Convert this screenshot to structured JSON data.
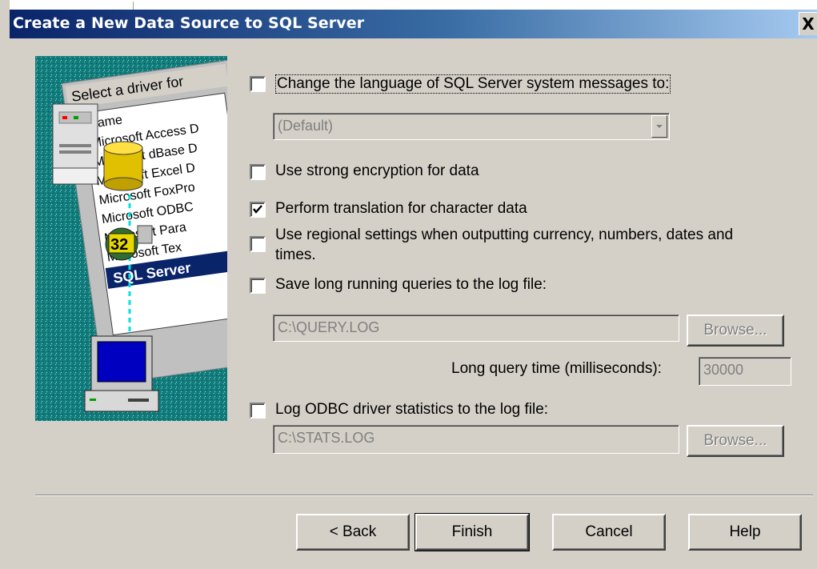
{
  "window": {
    "title": "Create a New Data Source to SQL Server",
    "close_glyph": "X"
  },
  "art": {
    "heading": "Select a driver for",
    "column": "Name",
    "drivers": [
      "Microsoft Access D",
      "Microsoft dBase D",
      "Microsoft Excel D",
      "Microsoft FoxPro",
      "Microsoft ODBC",
      "Microsoft Para",
      "Microsoft Tex",
      "SQL Server"
    ],
    "badge": "32",
    "icons": [
      "server-icon",
      "database-icon",
      "globe-icon",
      "computer-icon"
    ]
  },
  "options": {
    "change_language": {
      "label": "Change the language of SQL Server system messages to:",
      "checked": false
    },
    "language_combo": {
      "value": "(Default)"
    },
    "strong_encryption": {
      "label": "Use strong encryption for data",
      "checked": false
    },
    "translation": {
      "label": "Perform translation for character data",
      "checked": true
    },
    "regional": {
      "label_line1": "Use regional settings when outputting currency, numbers, dates and",
      "label_line2": "times.",
      "checked": false
    },
    "save_long_queries": {
      "label": "Save long running queries to the log file:",
      "checked": false
    },
    "query_log_path": {
      "value": "C:\\QUERY.LOG"
    },
    "browse1": {
      "label": "Browse..."
    },
    "long_query_time": {
      "label": "Long query time (milliseconds):",
      "value": "30000"
    },
    "log_stats": {
      "label": "Log ODBC driver statistics to the log file:",
      "checked": false
    },
    "stats_log_path": {
      "value": "C:\\STATS.LOG"
    },
    "browse2": {
      "label": "Browse..."
    }
  },
  "buttons": {
    "back": "< Back",
    "finish": "Finish",
    "cancel": "Cancel",
    "help": "Help"
  },
  "colors": {
    "titlebar_start": "#0a246a",
    "titlebar_end": "#a6caf0",
    "face": "#d4d0c8",
    "art_teal": "#127c7c"
  }
}
